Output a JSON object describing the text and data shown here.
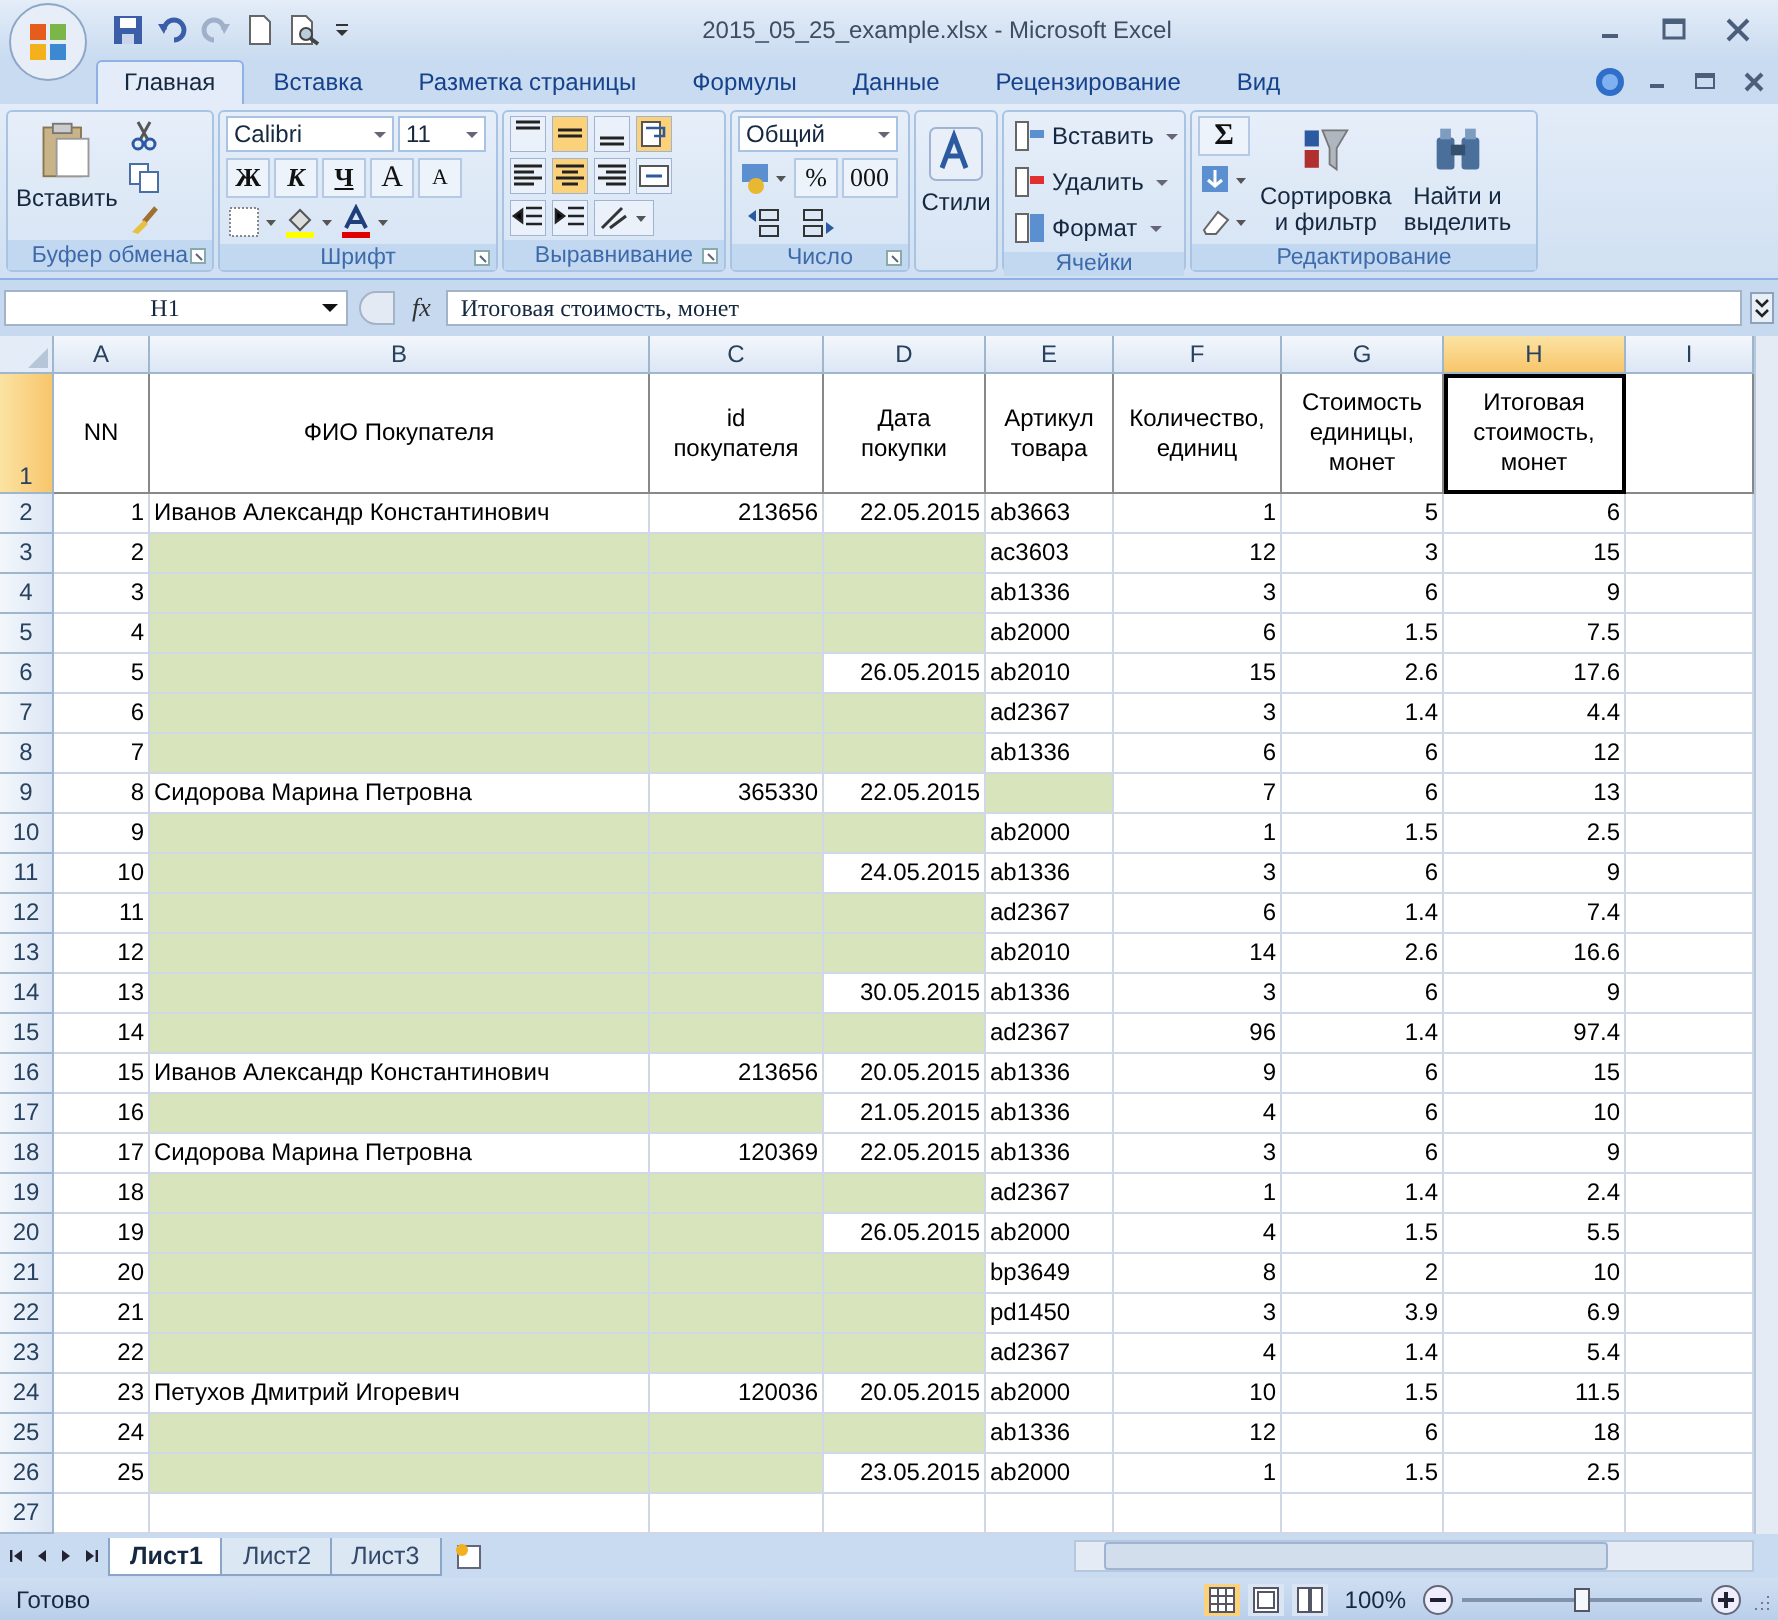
{
  "window": {
    "title": "2015_05_25_example.xlsx - Microsoft Excel"
  },
  "tabs": [
    {
      "label": "Главная",
      "selected": true
    },
    {
      "label": "Вставка",
      "selected": false
    },
    {
      "label": "Разметка страницы",
      "selected": false
    },
    {
      "label": "Формулы",
      "selected": false
    },
    {
      "label": "Данные",
      "selected": false
    },
    {
      "label": "Рецензирование",
      "selected": false
    },
    {
      "label": "Вид",
      "selected": false
    }
  ],
  "ribbon": {
    "clipboard": {
      "label": "Буфер обмена",
      "paste": "Вставить"
    },
    "font": {
      "label": "Шрифт",
      "family": "Calibri",
      "size": "11",
      "bold": "Ж",
      "italic": "К",
      "underline": "Ч",
      "grow": "A",
      "shrink": "A"
    },
    "alignment": {
      "label": "Выравнивание",
      "buttons": [
        {
          "kind": "top",
          "selected": false
        },
        {
          "kind": "middle",
          "selected": true
        },
        {
          "kind": "bottom",
          "selected": false
        },
        {
          "kind": "wrap",
          "selected": true
        },
        {
          "kind": "left",
          "selected": false
        },
        {
          "kind": "center",
          "selected": true
        },
        {
          "kind": "right",
          "selected": false
        },
        {
          "kind": "merge",
          "selected": false
        }
      ]
    },
    "number": {
      "label": "Число",
      "format": "Общий",
      "percent": "%",
      "thousands": "000"
    },
    "styles": {
      "button": "Стили"
    },
    "cells": {
      "label": "Ячейки",
      "buttons": [
        "Вставить",
        "Удалить",
        "Формат"
      ]
    },
    "editing": {
      "label": "Редактирование",
      "sum": "Σ",
      "sort": "Сортировка\nи фильтр",
      "find": "Найти и\nвыделить"
    }
  },
  "formula_bar": {
    "cell": "H1",
    "fx": "fx",
    "value": "Итоговая стоимость, монет"
  },
  "columns": [
    {
      "label": "A",
      "selected": false
    },
    {
      "label": "B",
      "selected": false
    },
    {
      "label": "C",
      "selected": false
    },
    {
      "label": "D",
      "selected": false
    },
    {
      "label": "E",
      "selected": false
    },
    {
      "label": "F",
      "selected": false
    },
    {
      "label": "G",
      "selected": false
    },
    {
      "label": "H",
      "selected": true
    },
    {
      "label": "I",
      "selected": false
    }
  ],
  "header": {
    "row": "1",
    "selected": true,
    "cells": [
      {
        "text": "NN",
        "selected": false
      },
      {
        "text": "ФИО Покупателя",
        "selected": false
      },
      {
        "text": "id покупателя",
        "selected": false
      },
      {
        "text": "Дата покупки",
        "selected": false
      },
      {
        "text": "Артикул товара",
        "selected": false
      },
      {
        "text": "Количество, единиц",
        "selected": false
      },
      {
        "text": "Стоимость единицы, монет",
        "selected": false
      },
      {
        "text": "Итоговая стоимость, монет",
        "selected": true
      }
    ]
  },
  "rows": [
    {
      "row": "2",
      "nn": "1",
      "name": "Иванов Александр Константинович",
      "id": "213656",
      "date": "22.05.2015",
      "article": "ab3663",
      "qty": "1",
      "price": "5",
      "total": "6"
    },
    {
      "row": "3",
      "nn": "2",
      "article": "ac3603",
      "qty": "12",
      "price": "3",
      "total": "15"
    },
    {
      "row": "4",
      "nn": "3",
      "article": "ab1336",
      "qty": "3",
      "price": "6",
      "total": "9"
    },
    {
      "row": "5",
      "nn": "4",
      "article": "ab2000",
      "qty": "6",
      "price": "1.5",
      "total": "7.5"
    },
    {
      "row": "6",
      "nn": "5",
      "date": "26.05.2015",
      "article": "ab2010",
      "qty": "15",
      "price": "2.6",
      "total": "17.6"
    },
    {
      "row": "7",
      "nn": "6",
      "article": "ad2367",
      "qty": "3",
      "price": "1.4",
      "total": "4.4"
    },
    {
      "row": "8",
      "nn": "7",
      "article": "ab1336",
      "qty": "6",
      "price": "6",
      "total": "12"
    },
    {
      "row": "9",
      "nn": "8",
      "name": "Сидорова Марина Петровна",
      "id": "365330",
      "date": "22.05.2015",
      "qty": "7",
      "price": "6",
      "total": "13"
    },
    {
      "row": "10",
      "nn": "9",
      "article": "ab2000",
      "qty": "1",
      "price": "1.5",
      "total": "2.5"
    },
    {
      "row": "11",
      "nn": "10",
      "date": "24.05.2015",
      "article": "ab1336",
      "qty": "3",
      "price": "6",
      "total": "9"
    },
    {
      "row": "12",
      "nn": "11",
      "article": "ad2367",
      "qty": "6",
      "price": "1.4",
      "total": "7.4"
    },
    {
      "row": "13",
      "nn": "12",
      "article": "ab2010",
      "qty": "14",
      "price": "2.6",
      "total": "16.6"
    },
    {
      "row": "14",
      "nn": "13",
      "date": "30.05.2015",
      "article": "ab1336",
      "qty": "3",
      "price": "6",
      "total": "9"
    },
    {
      "row": "15",
      "nn": "14",
      "article": "ad2367",
      "qty": "96",
      "price": "1.4",
      "total": "97.4"
    },
    {
      "row": "16",
      "nn": "15",
      "name": "Иванов Александр Константинович",
      "id": "213656",
      "date": "20.05.2015",
      "article": "ab1336",
      "qty": "9",
      "price": "6",
      "total": "15"
    },
    {
      "row": "17",
      "nn": "16",
      "date": "21.05.2015",
      "article": "ab1336",
      "qty": "4",
      "price": "6",
      "total": "10"
    },
    {
      "row": "18",
      "nn": "17",
      "name": "Сидорова Марина Петровна",
      "id": "120369",
      "date": "22.05.2015",
      "article": "ab1336",
      "qty": "3",
      "price": "6",
      "total": "9"
    },
    {
      "row": "19",
      "nn": "18",
      "article": "ad2367",
      "qty": "1",
      "price": "1.4",
      "total": "2.4"
    },
    {
      "row": "20",
      "nn": "19",
      "date": "26.05.2015",
      "article": "ab2000",
      "qty": "4",
      "price": "1.5",
      "total": "5.5"
    },
    {
      "row": "21",
      "nn": "20",
      "article": "bp3649",
      "qty": "8",
      "price": "2",
      "total": "10"
    },
    {
      "row": "22",
      "nn": "21",
      "article": "pd1450",
      "qty": "3",
      "price": "3.9",
      "total": "6.9"
    },
    {
      "row": "23",
      "nn": "22",
      "article": "ad2367",
      "qty": "4",
      "price": "1.4",
      "total": "5.4"
    },
    {
      "row": "24",
      "nn": "23",
      "name": "Петухов Дмитрий Игоревич",
      "id": "120036",
      "date": "20.05.2015",
      "article": "ab2000",
      "qty": "10",
      "price": "1.5",
      "total": "11.5"
    },
    {
      "row": "25",
      "nn": "24",
      "article": "ab1336",
      "qty": "12",
      "price": "6",
      "total": "18"
    },
    {
      "row": "26",
      "nn": "25",
      "date": "23.05.2015",
      "article": "ab2000",
      "qty": "1",
      "price": "1.5",
      "total": "2.5"
    }
  ],
  "empty_rows": [
    "27"
  ],
  "sheet_tabs": [
    {
      "label": "Лист1",
      "selected": true
    },
    {
      "label": "Лист2",
      "selected": false
    },
    {
      "label": "Лист3",
      "selected": false
    }
  ],
  "status_bar": {
    "status": "Готово",
    "views": [
      {
        "kind": "normal",
        "selected": true
      },
      {
        "kind": "layout",
        "selected": false
      },
      {
        "kind": "pagebreak",
        "selected": false
      }
    ],
    "zoom": {
      "label": "100%",
      "level": 0.5
    }
  }
}
